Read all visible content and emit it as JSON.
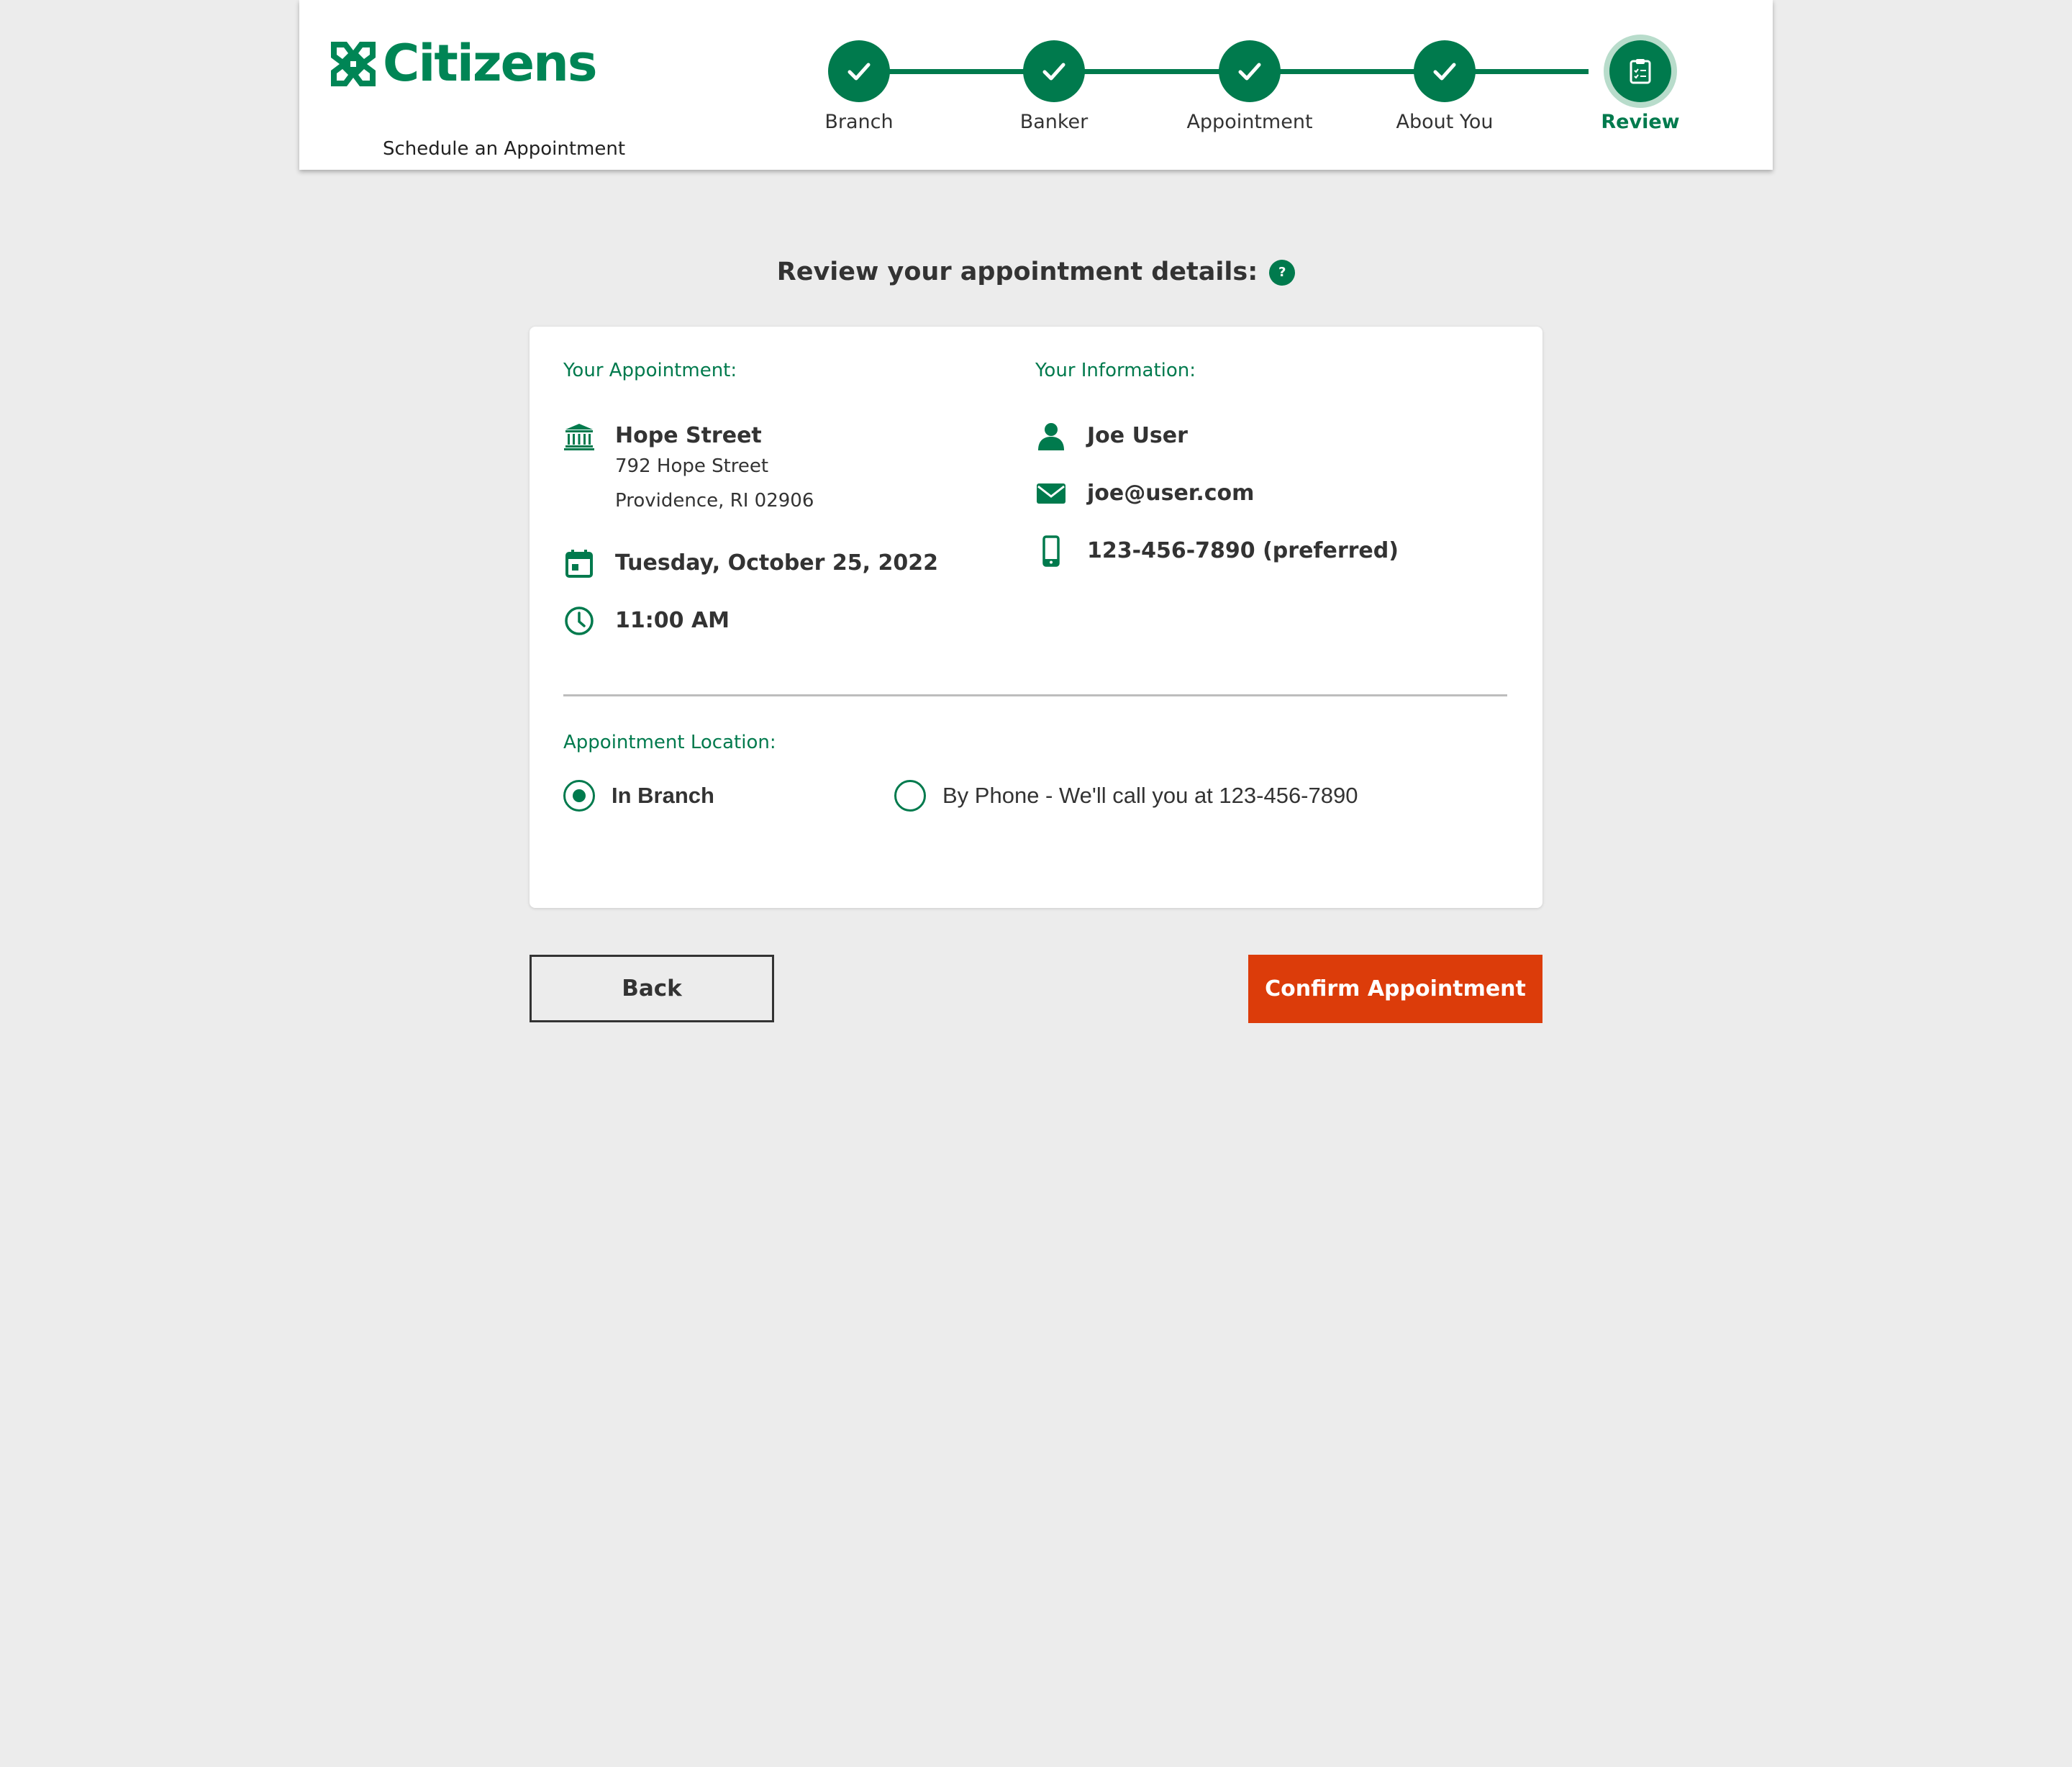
{
  "header": {
    "brand": "Citizens",
    "trademark": "™",
    "subtitle": "Schedule an Appointment"
  },
  "steps": [
    {
      "label": "Branch",
      "state": "complete",
      "icon": "check-icon"
    },
    {
      "label": "Banker",
      "state": "complete",
      "icon": "check-icon"
    },
    {
      "label": "Appointment",
      "state": "complete",
      "icon": "check-icon"
    },
    {
      "label": "About You",
      "state": "complete",
      "icon": "check-icon"
    },
    {
      "label": "Review",
      "state": "current",
      "icon": "clipboard-icon"
    }
  ],
  "review": {
    "title": "Review your appointment details:",
    "help_icon": "?"
  },
  "appointment": {
    "heading": "Your Appointment:",
    "branch_name": "Hope Street",
    "address_line1": "792 Hope Street",
    "address_line2": "Providence, RI 02906",
    "date": "Tuesday, October 25, 2022",
    "time": "11:00 AM"
  },
  "information": {
    "heading": "Your Information:",
    "name": "Joe User",
    "email": "joe@user.com",
    "phone": "123-456-7890 (preferred)"
  },
  "location": {
    "heading": "Appointment Location:",
    "options": [
      {
        "label": "In Branch",
        "selected": true
      },
      {
        "label": "By Phone - We'll call you at 123-456-7890",
        "selected": false
      }
    ]
  },
  "buttons": {
    "back": "Back",
    "confirm": "Confirm Appointment"
  },
  "colors": {
    "brand_green": "#007a4d",
    "confirm_orange": "#dc3c0a",
    "background": "#ececec"
  }
}
